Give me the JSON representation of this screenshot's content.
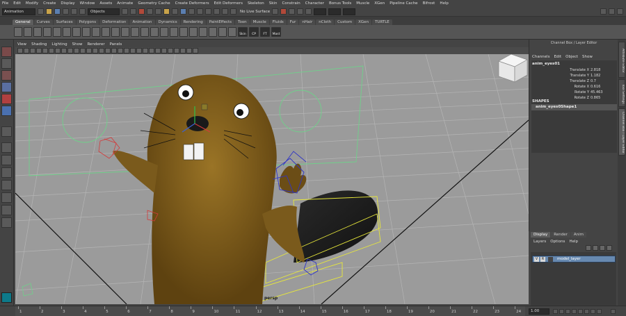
{
  "menubar": [
    "File",
    "Edit",
    "Modify",
    "Create",
    "Display",
    "Window",
    "Assets",
    "Animate",
    "Geometry Cache",
    "Create Deformers",
    "Edit Deformers",
    "Skeleton",
    "Skin",
    "Constrain",
    "Character",
    "Bonus Tools",
    "Muscle",
    "XGen",
    "Pipeline Cache",
    "Bifrost",
    "Help"
  ],
  "status": {
    "mode": "Animation",
    "selection_field": "Objects",
    "live_surface": "No Live Surface"
  },
  "shelf_tabs": [
    "General",
    "Curves",
    "Surfaces",
    "Polygons",
    "Deformation",
    "Animation",
    "Dynamics",
    "Rendering",
    "PaintEffects",
    "Toon",
    "Muscle",
    "Fluids",
    "Fur",
    "nHair",
    "nCloth",
    "Custom",
    "XGen",
    "TURTLE"
  ],
  "shelf_active": "General",
  "shelf_labels": [
    "Skin",
    "CP",
    "FT",
    "Mast"
  ],
  "panel_menu": [
    "View",
    "Shading",
    "Lighting",
    "Show",
    "Renderer",
    "Panels"
  ],
  "camera": "persp",
  "viewcube": {
    "front": "FRONT",
    "right": "RIGHT"
  },
  "channel_box": {
    "title": "Channel Box / Layer Editor",
    "menu": [
      "Channels",
      "Edit",
      "Object",
      "Show"
    ],
    "node": "anim_eyes01",
    "attributes": [
      {
        "name": "Translate X",
        "value": "2.818"
      },
      {
        "name": "Translate Y",
        "value": "1.182"
      },
      {
        "name": "Translate Z",
        "value": "0.7"
      },
      {
        "name": "Rotate X",
        "value": "0.616"
      },
      {
        "name": "Rotate Y",
        "value": "45.463"
      },
      {
        "name": "Rotate Z",
        "value": "0.865"
      }
    ],
    "shapes_header": "SHAPES",
    "shape_node": "anim_eyes0Shape1"
  },
  "side_tabs": [
    "Attribute Editor",
    "Tool Settings",
    "Channel Box / Layer Editor"
  ],
  "layer_editor": {
    "tabs": [
      "Display",
      "Render",
      "Anim"
    ],
    "active_tab": "Display",
    "menu": [
      "Layers",
      "Options",
      "Help"
    ],
    "layer": {
      "v": "V",
      "p": "R",
      "name": "model_layer"
    }
  },
  "timeline": {
    "ticks": [
      "1",
      "2",
      "3",
      "4",
      "5",
      "6",
      "7",
      "8",
      "9",
      "10",
      "11",
      "12",
      "13",
      "14",
      "15",
      "16",
      "17",
      "18",
      "19",
      "20",
      "21",
      "22",
      "23",
      "24"
    ],
    "current_time": "1.00"
  },
  "colors": {
    "viewport_bg": "#9b9b9b",
    "beaver_body": "#7a5a1c",
    "control_yellow": "#e8e83a",
    "control_blue": "#2f34c4",
    "control_red": "#d43a3a",
    "camera_frame": "#6fd18a",
    "layer_highlight": "#6789b0"
  }
}
